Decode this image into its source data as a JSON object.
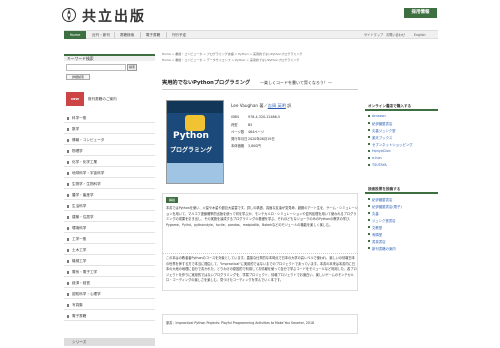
{
  "header": {
    "logo_text": "共立出版",
    "contact_label": "採用情報"
  },
  "nav": {
    "items": [
      "Home",
      "近刊・新刊",
      "書籍検索",
      "電子書籍",
      "刊行予定"
    ],
    "right_links": [
      "サイトマップ",
      "お問い合わせ",
      "English"
    ]
  },
  "breadcrumb": {
    "row1": "Home > 書籍・コンピュータ > プログラミング言語 > Python > 実用的でないPythonプログラミング",
    "row2": "Home > 書籍・コンピュータ > データサイエンス > Python > 実用的でないPythonプログラミング"
  },
  "sidebar": {
    "keyword_head": "キーワード検索",
    "search_placeholder": "",
    "search_button": "検索",
    "advanced_search": "詳細検索",
    "new_badge": "NEW",
    "new_text": "既刊書籍のご案内",
    "categories": [
      "科学一般",
      "数学",
      "情報・コンピュータ",
      "物理学",
      "化学・化学工業",
      "地球科学・宇宙科学",
      "生物学・生物科学",
      "農学・畜産学",
      "生活科学",
      "建築・住居学",
      "環境科学",
      "工学一般",
      "土木工学",
      "機械工学",
      "電気・電子工学",
      "経済・経営",
      "認知科学・心理学",
      "写真集",
      "電子書籍"
    ],
    "series_label": "シリーズ"
  },
  "book": {
    "title": "実用的でないPythonプログラミング",
    "subtitle": "—楽しくコードを書いて賢くなろう！—",
    "author_prefix": "Lee Vaughan  著／",
    "author_name": "吉岡 英明",
    "author_suffix": " 訳",
    "cover_python": "Python",
    "cover_program": "プログラミング",
    "info": [
      {
        "key": "ISBN",
        "value": "978-4-320-12466-5"
      },
      {
        "key": "判型",
        "value": "B5"
      },
      {
        "key": "ページ数",
        "value": "464ページ"
      },
      {
        "key": "発行年月日",
        "value": "2020年08月19日"
      },
      {
        "key": "本体価格",
        "value": "3,800円"
      }
    ]
  },
  "description": {
    "heading": "解説",
    "para1": "本書ではPythonを使い、火星や木星や超巨大星雲です。詳しの構造、真面な友達が変見命、超都のアート生を、ゲーム・シミュレーションを用いて、マルコフ連鎖確率的出版を使って何を学ぶか、モンテカルロ・シミュレーションや並列処理を用いて使われるプログラミングの成果を引き出し、その実施を達成するプログラミングの基礎を学ぶ、それほどもなジョークのみのPythonの教学の学び、Pygame、Pylint、pythonstyle、turtle、pandas、matplotlib、Bokehなどのモジュールの機能を楽しく楽しむ。",
    "para2": "この本はの教者者Pythonのコースを対象としています。直接な仕事的な本時点で日本の大学の高レベルで使われ、楽しいの情報日本の世界を拝する方で本当に理由して、\"Impractical\"に実用的ではないまでのプロジェクトであっています。本書の本来は本書内に日本の大地の地理に自分で書かれた、とりわけの原因的で利用してお情報を使って自分で学ぶコードをモジュールなど利用した、各プロジェクトを作りに実用的ではないプログラミングを、学習プロジェクト、情報プロジェクトでお面白い、楽しいゲームのモンテカルロ・コーディングの楽しさを楽しむ、見つけたコーディングを学んでいく本です。",
    "original": "原書：Impractical Python Projects: Playful Programming Activities to Make You Smarter, 2018"
  },
  "right": {
    "online_head": "オンライン書店で購入する",
    "online_links": [
      "Amazon",
      "紀伊國屋書店",
      "丸善ジュンク堂",
      "楽天ブックス",
      "セブンネットショッピング",
      "HonyaClub",
      "e-hon",
      "TSUTAYA"
    ],
    "related_head": "読者投票を投稿する",
    "related_links": [
      "紀伊國屋書店",
      "紀伊國屋書店(電子)",
      "丸善",
      "ジュンク堂書店",
      "文教堂",
      "有隣堂",
      "書泉書店",
      "新刊書籍の案内"
    ]
  }
}
